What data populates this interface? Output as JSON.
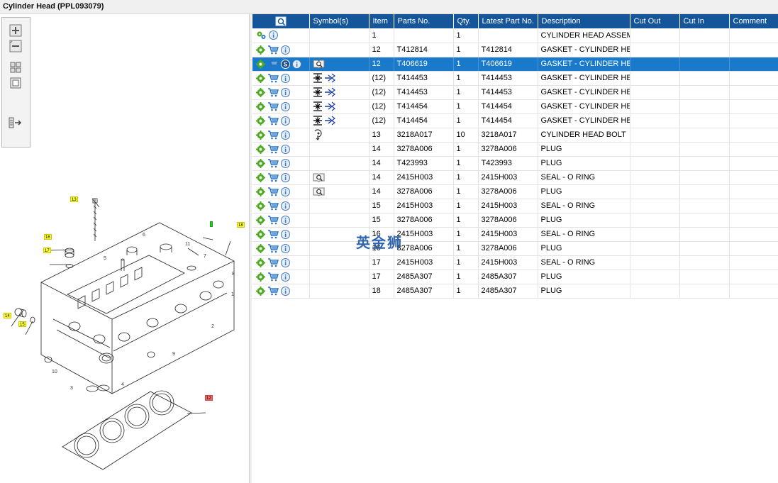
{
  "window": {
    "title": "Cylinder Head (PPL093079)"
  },
  "toolbar": {
    "items": [
      {
        "name": "zoom-in",
        "icon": "zoom-in-icon"
      },
      {
        "name": "zoom-out",
        "icon": "zoom-out-icon"
      },
      {
        "name": "fit-all",
        "icon": "fit-all-icon"
      },
      {
        "name": "fit-window",
        "icon": "fit-window-icon"
      },
      {
        "name": "show-list",
        "icon": "list-arrow-icon"
      }
    ]
  },
  "diagram": {
    "callouts": [
      "13",
      "16",
      "17",
      "14",
      "15",
      "18",
      "12"
    ],
    "labels": [
      "11",
      "6",
      "5",
      "7",
      "8",
      "1",
      "2",
      "9",
      "10",
      "3",
      "4"
    ]
  },
  "table": {
    "columns": [
      "",
      "Symbol(s)",
      "Item",
      "Parts No.",
      "Qty.",
      "Latest Part No.",
      "Description",
      "Cut Out",
      "Cut In",
      "Comment"
    ],
    "rows": [
      {
        "icons": [
          "assembly-icon",
          "info-icon"
        ],
        "symbol": "",
        "item": "1",
        "part": "",
        "qty": "1",
        "latest": "",
        "desc": "CYLINDER HEAD ASSEMB",
        "selected": false
      },
      {
        "icons": [
          "gear-icon",
          "cart-icon",
          "info-icon"
        ],
        "symbol": "",
        "item": "12",
        "part": "T412814",
        "qty": "1",
        "latest": "T412814",
        "desc": "GASKET - CYLINDER HEAD",
        "selected": false
      },
      {
        "icons": [
          "gear-icon",
          "cart-icon",
          "s-badge-icon",
          "info-icon"
        ],
        "symbol": "book-search-icon",
        "item": "12",
        "part": "T406619",
        "qty": "1",
        "latest": "T406619",
        "desc": "GASKET - CYLINDER HEAD",
        "selected": true
      },
      {
        "icons": [
          "gear-icon",
          "cart-icon",
          "info-icon"
        ],
        "symbol": "interchange-icon",
        "item": "(12)",
        "part": "T414453",
        "qty": "1",
        "latest": "T414453",
        "desc": "GASKET - CYLINDER HEAD",
        "selected": false
      },
      {
        "icons": [
          "gear-icon",
          "cart-icon",
          "info-icon"
        ],
        "symbol": "interchange-icon",
        "item": "(12)",
        "part": "T414453",
        "qty": "1",
        "latest": "T414453",
        "desc": "GASKET - CYLINDER HEAD",
        "selected": false
      },
      {
        "icons": [
          "gear-icon",
          "cart-icon",
          "info-icon"
        ],
        "symbol": "interchange-icon",
        "item": "(12)",
        "part": "T414454",
        "qty": "1",
        "latest": "T414454",
        "desc": "GASKET - CYLINDER HEAD",
        "selected": false
      },
      {
        "icons": [
          "gear-icon",
          "cart-icon",
          "info-icon"
        ],
        "symbol": "interchange-icon",
        "item": "(12)",
        "part": "T414454",
        "qty": "1",
        "latest": "T414454",
        "desc": "GASKET - CYLINDER HEAD",
        "selected": false
      },
      {
        "icons": [
          "gear-icon",
          "cart-icon",
          "info-icon"
        ],
        "symbol": "torque-icon",
        "item": "13",
        "part": "3218A017",
        "qty": "10",
        "latest": "3218A017",
        "desc": "CYLINDER HEAD BOLT",
        "selected": false
      },
      {
        "icons": [
          "gear-icon",
          "cart-icon",
          "info-icon"
        ],
        "symbol": "",
        "item": "14",
        "part": "3278A006",
        "qty": "1",
        "latest": "3278A006",
        "desc": "PLUG",
        "selected": false
      },
      {
        "icons": [
          "gear-icon",
          "cart-icon",
          "info-icon"
        ],
        "symbol": "",
        "item": "14",
        "part": "T423993",
        "qty": "1",
        "latest": "T423993",
        "desc": "PLUG",
        "selected": false
      },
      {
        "icons": [
          "gear-icon",
          "cart-icon",
          "info-icon"
        ],
        "symbol": "book-search-icon",
        "item": "14",
        "part": "2415H003",
        "qty": "1",
        "latest": "2415H003",
        "desc": "SEAL - O RING",
        "selected": false
      },
      {
        "icons": [
          "gear-icon",
          "cart-icon",
          "info-icon"
        ],
        "symbol": "book-search-icon",
        "item": "14",
        "part": "3278A006",
        "qty": "1",
        "latest": "3278A006",
        "desc": "PLUG",
        "selected": false
      },
      {
        "icons": [
          "gear-icon",
          "cart-icon",
          "info-icon"
        ],
        "symbol": "",
        "item": "15",
        "part": "2415H003",
        "qty": "1",
        "latest": "2415H003",
        "desc": "SEAL - O RING",
        "selected": false
      },
      {
        "icons": [
          "gear-icon",
          "cart-icon",
          "info-icon"
        ],
        "symbol": "",
        "item": "15",
        "part": "3278A006",
        "qty": "1",
        "latest": "3278A006",
        "desc": "PLUG",
        "selected": false
      },
      {
        "icons": [
          "gear-icon",
          "cart-icon",
          "info-icon"
        ],
        "symbol": "",
        "item": "16",
        "part": "2415H003",
        "qty": "1",
        "latest": "2415H003",
        "desc": "SEAL - O RING",
        "selected": false
      },
      {
        "icons": [
          "gear-icon",
          "cart-icon",
          "info-icon"
        ],
        "symbol": "",
        "item": "16",
        "part": "3278A006",
        "qty": "1",
        "latest": "3278A006",
        "desc": "PLUG",
        "selected": false
      },
      {
        "icons": [
          "gear-icon",
          "cart-icon",
          "info-icon"
        ],
        "symbol": "",
        "item": "17",
        "part": "2415H003",
        "qty": "1",
        "latest": "2415H003",
        "desc": "SEAL - O RING",
        "selected": false
      },
      {
        "icons": [
          "gear-icon",
          "cart-icon",
          "info-icon"
        ],
        "symbol": "",
        "item": "17",
        "part": "2485A307",
        "qty": "1",
        "latest": "2485A307",
        "desc": "PLUG",
        "selected": false
      },
      {
        "icons": [
          "gear-icon",
          "cart-icon",
          "info-icon"
        ],
        "symbol": "",
        "item": "18",
        "part": "2485A307",
        "qty": "1",
        "latest": "2485A307",
        "desc": "PLUG",
        "selected": false
      }
    ]
  },
  "watermark": "英金狮",
  "colors": {
    "header": "#15559a",
    "selection": "#1979ca",
    "callout": "#ffff33",
    "watermark": "#1d57a8"
  }
}
